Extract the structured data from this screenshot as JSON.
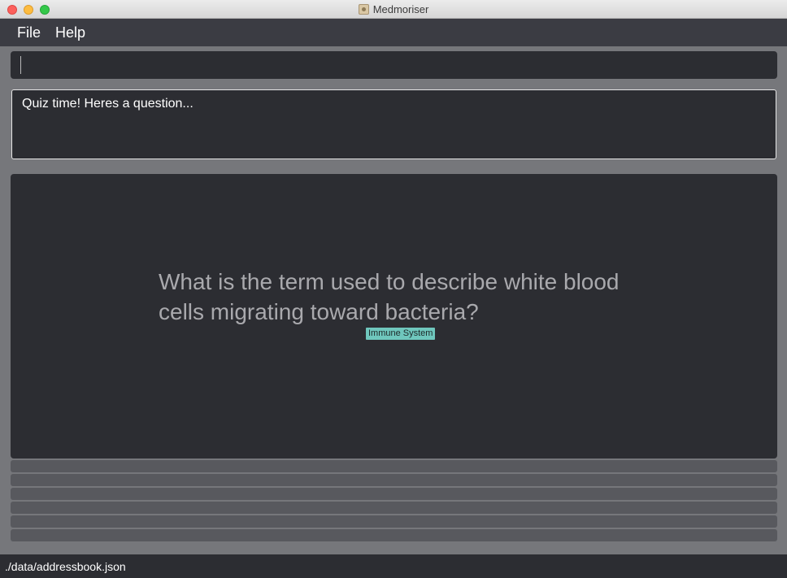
{
  "window": {
    "title": "Medmoriser"
  },
  "menu": {
    "file": "File",
    "help": "Help"
  },
  "command": {
    "value": ""
  },
  "result": {
    "text": "Quiz time! Heres a question..."
  },
  "question": {
    "text": "What is the term used to describe white blood cells migrating toward bacteria?",
    "tag": "Immune System"
  },
  "status": {
    "file_path": "./data/addressbook.json"
  },
  "colors": {
    "tag_background": "#6fc7bd",
    "panel_background": "#2c2d32",
    "menubar_background": "#3b3c43"
  }
}
